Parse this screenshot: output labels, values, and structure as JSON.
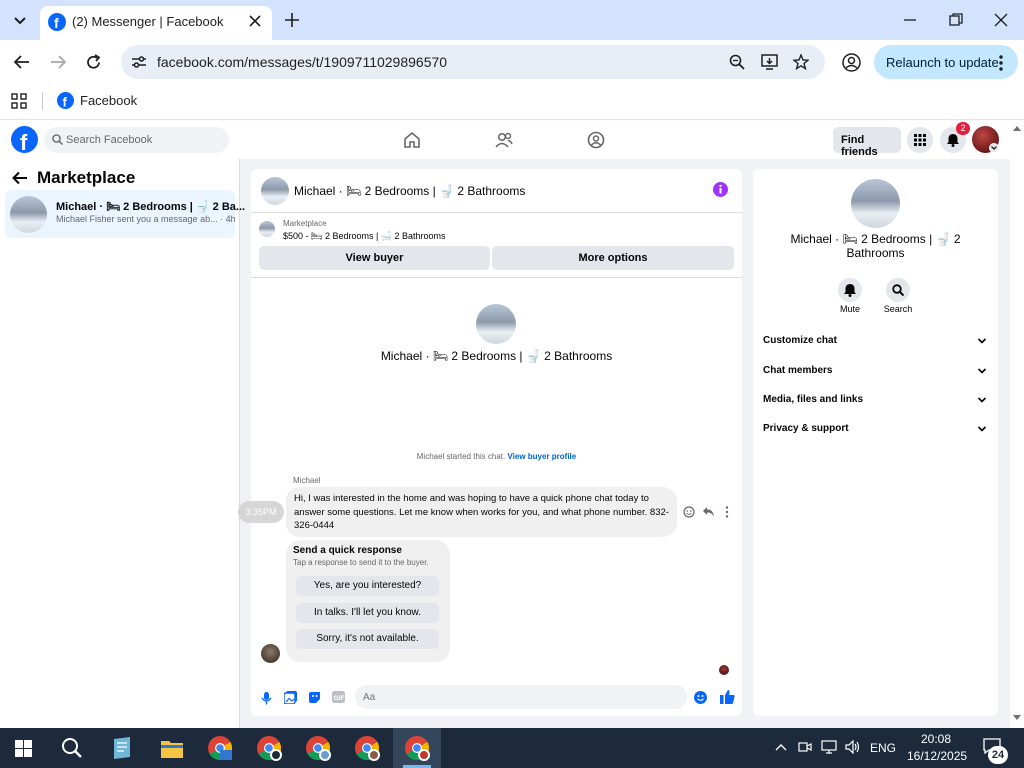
{
  "browser": {
    "tab_title": "(2) Messenger | Facebook",
    "url": "facebook.com/messages/t/1909711029896570",
    "relaunch_label": "Relaunch to update",
    "bookmark_facebook": "Facebook"
  },
  "fb_header": {
    "search_placeholder": "Search Facebook",
    "find_friends": "Find friends",
    "notification_count": "2"
  },
  "left_panel": {
    "title": "Marketplace",
    "conversation": {
      "name": "Michael · 🛏 2 Bedrooms | 🚽 2 Ba...",
      "preview": "Michael Fisher sent you a message ab... · 4h"
    }
  },
  "chat": {
    "header_name": "Michael · 🛏 2 Bedrooms | 🚽 2 Bathrooms",
    "marketplace_label": "Marketplace",
    "listing": "$500 - 🛏 2 Bedrooms | 🛁 2 Bathrooms",
    "view_buyer": "View buyer",
    "more_options": "More options",
    "center_name": "Michael · 🛏 2 Bedrooms | 🚽 2 Bathrooms",
    "started_text": "Michael started this chat.",
    "started_link": "View buyer profile",
    "timestamp": "3:35PM",
    "sender": "Michael",
    "message": "Hi, I was interested in the home and was hoping to have a quick phone chat today to answer some questions. Let me know when works for you, and what phone number. 832-326-0444",
    "quick_title": "Send a quick response",
    "quick_sub": "Tap a response to send it to the buyer.",
    "quick_replies": [
      "Yes, are you interested?",
      "In talks. I'll let you know.",
      "Sorry, it's not available."
    ],
    "composer_placeholder": "Aa"
  },
  "info_panel": {
    "name": "Michael · 🛏 2 Bedrooms | 🚽 2 Bathrooms",
    "mute": "Mute",
    "search": "Search",
    "sections": [
      "Customize chat",
      "Chat members",
      "Media, files and links",
      "Privacy & support"
    ]
  },
  "taskbar": {
    "language": "ENG",
    "time": "20:08",
    "date": "16/12/2025",
    "notification_count": "24"
  },
  "colors": {
    "fb_blue": "#0866ff",
    "accent_purple": "#a033ff",
    "notification_red": "#e41e3f"
  }
}
